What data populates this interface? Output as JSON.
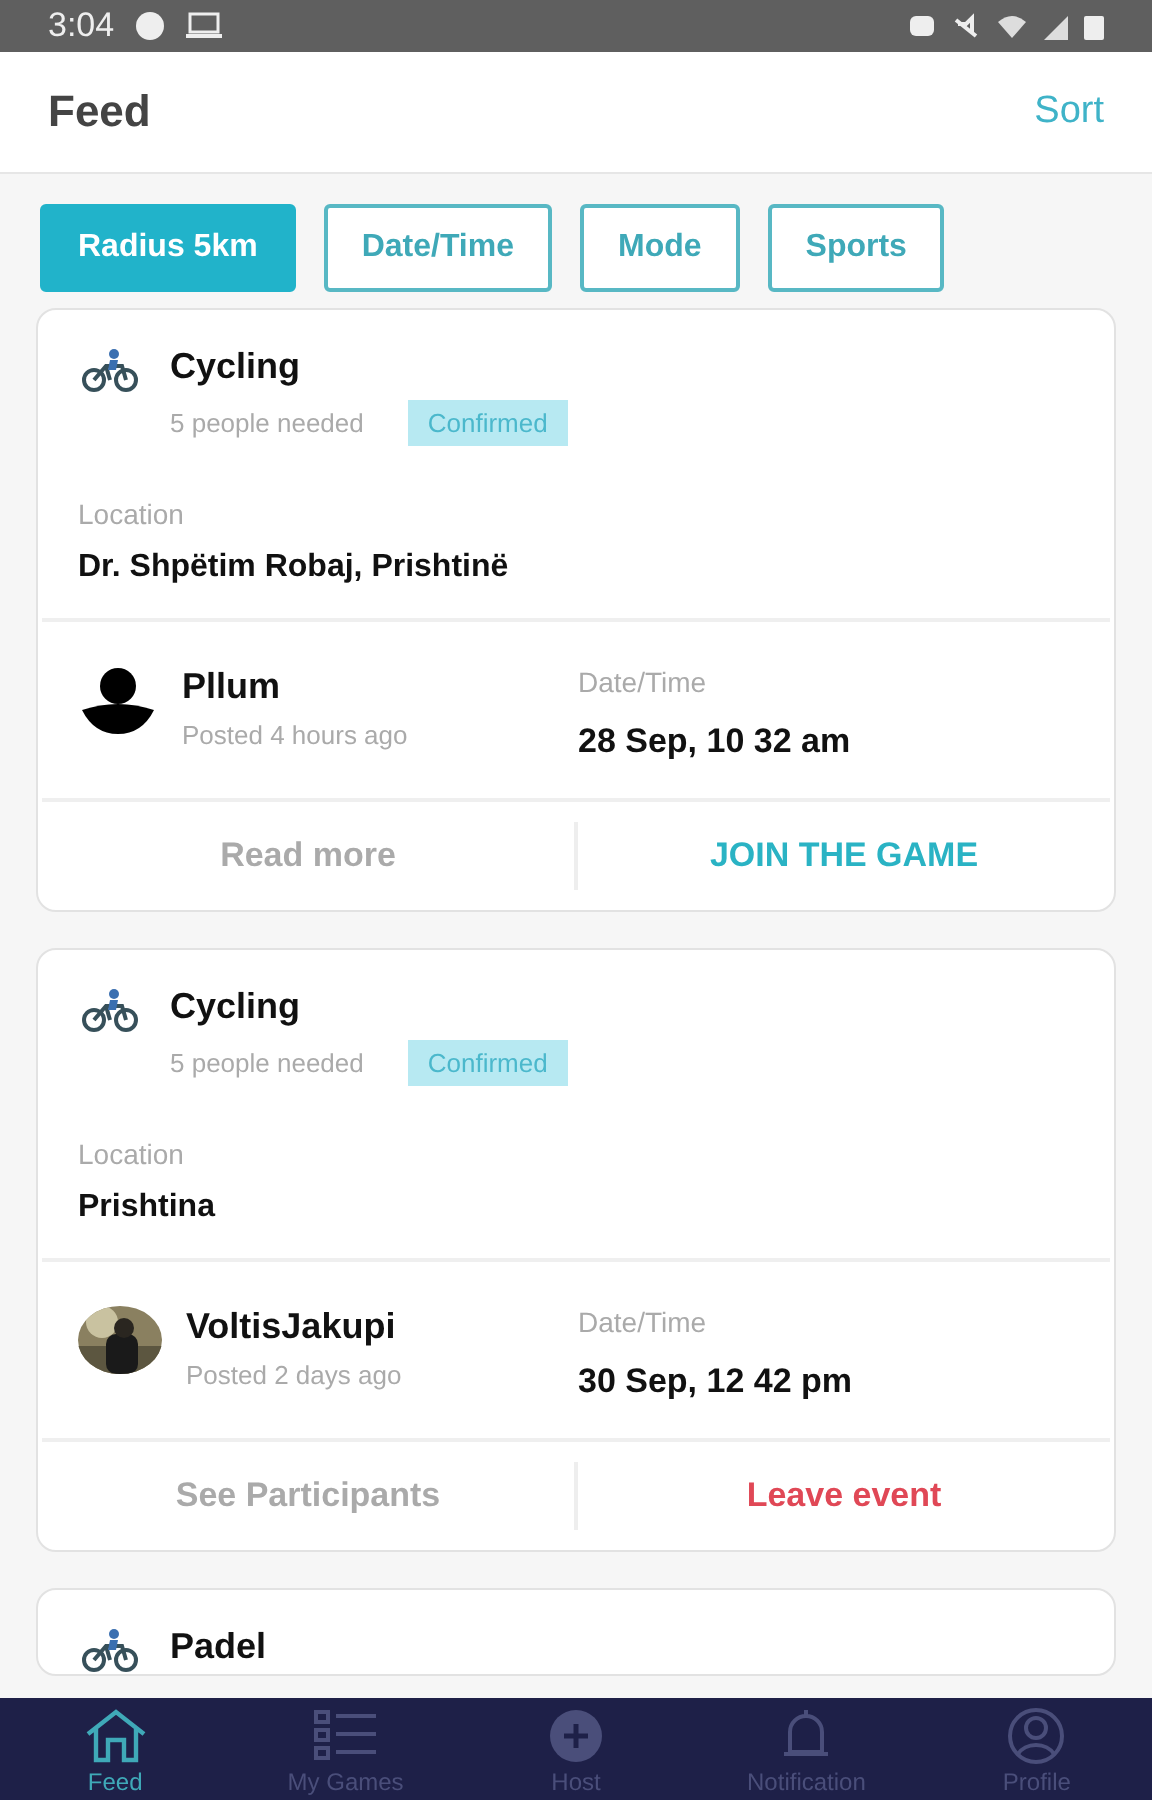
{
  "status_bar": {
    "time": "3:04"
  },
  "header": {
    "title": "Feed",
    "action": "Sort"
  },
  "filters": [
    {
      "label": "Radius 5km",
      "selected": true
    },
    {
      "label": "Date/Time",
      "selected": false
    },
    {
      "label": "Mode",
      "selected": false
    },
    {
      "label": "Sports",
      "selected": false
    }
  ],
  "cards": [
    {
      "sport": "Cycling",
      "needed": "5 people needed",
      "badge": "Confirmed",
      "location_label": "Location",
      "location": "Dr. Shpëtim Robaj, Prishtinë",
      "avatar": {
        "kind": "silhouette"
      },
      "user": "Pllum",
      "posted": "Posted 4 hours ago",
      "date_label": "Date/Time",
      "date": "28 Sep, 10 32 am",
      "actions": [
        {
          "label": "Read more",
          "kind": "muted"
        },
        {
          "label": "JOIN THE GAME",
          "kind": "primary"
        }
      ]
    },
    {
      "sport": "Cycling",
      "needed": "5 people needed",
      "badge": "Confirmed",
      "location_label": "Location",
      "location": "Prishtina",
      "avatar": {
        "kind": "picture"
      },
      "user": "VoltisJakupi",
      "posted": "Posted 2 days ago",
      "date_label": "Date/Time",
      "date": "30 Sep, 12 42 pm",
      "actions": [
        {
          "label": "See Participants",
          "kind": "muted"
        },
        {
          "label": "Leave event",
          "kind": "danger"
        }
      ]
    },
    {
      "sport": "Padel"
    }
  ],
  "nav": [
    {
      "label": "Feed",
      "kind": "home",
      "selected": true
    },
    {
      "label": "My Games",
      "kind": "list",
      "selected": false
    },
    {
      "label": "Host",
      "kind": "plus",
      "selected": false
    },
    {
      "label": "Notification",
      "kind": "bell",
      "selected": false
    },
    {
      "label": "Profile",
      "kind": "profile",
      "selected": false
    }
  ]
}
